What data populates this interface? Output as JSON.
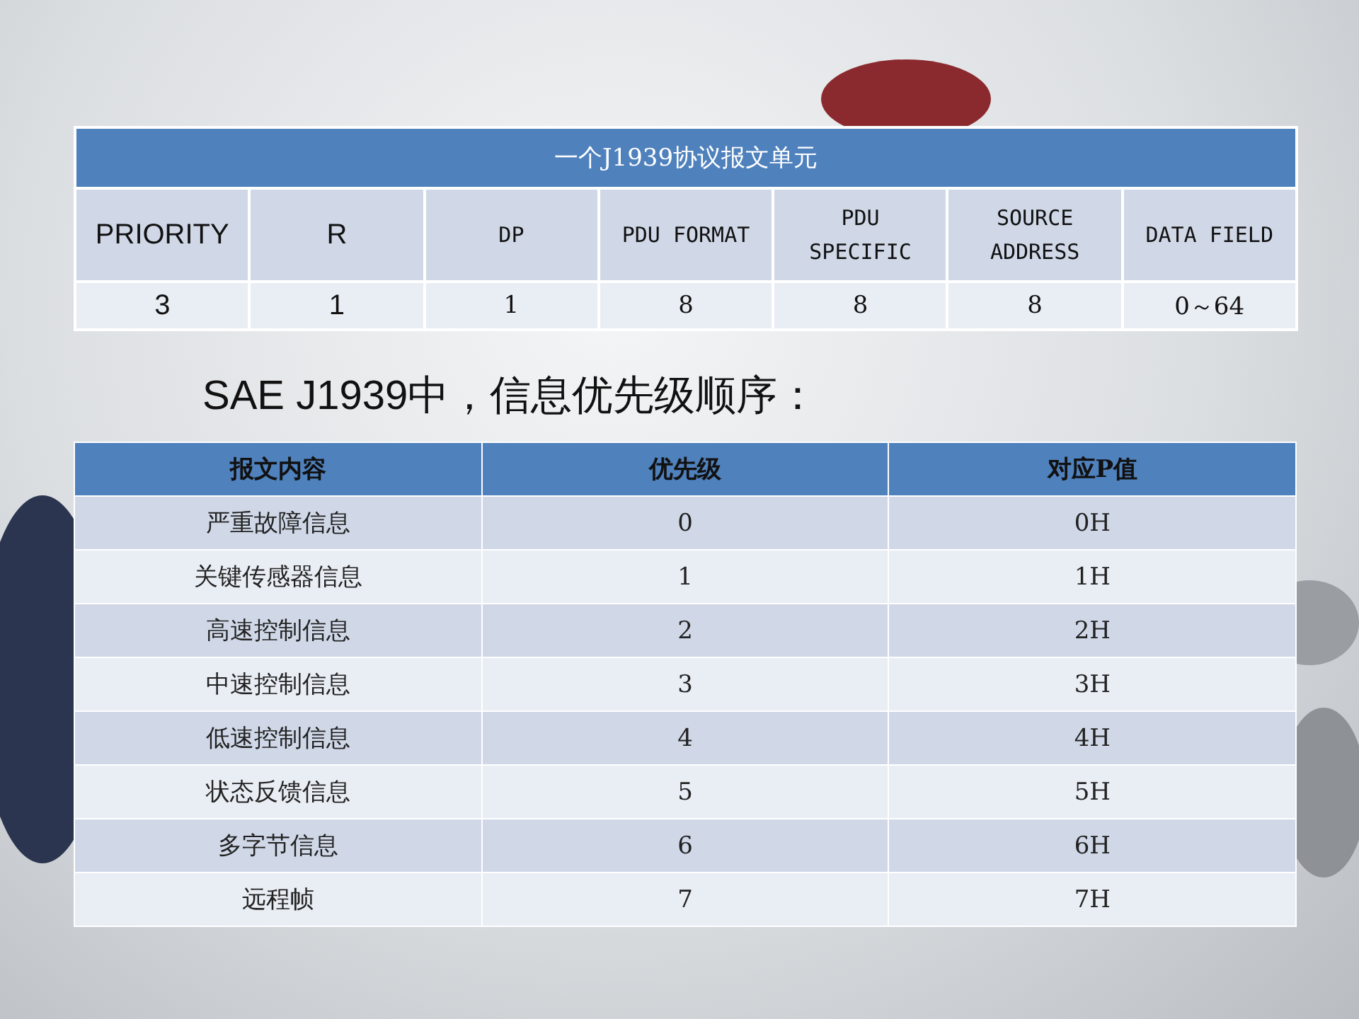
{
  "frame_table": {
    "title": "一个J1939协议报文单元",
    "columns": [
      "PRIORITY",
      "R",
      "DP",
      "PDU FORMAT",
      "PDU\nSPECIFIC",
      "SOURCE\nADDRESS",
      "DATA FIELD"
    ],
    "values": [
      "3",
      "1",
      "1",
      "8",
      "8",
      "8",
      "0～64"
    ]
  },
  "heading": "SAE J1939中，信息优先级顺序：",
  "priority_table": {
    "columns": [
      "报文内容",
      "优先级",
      "对应P值"
    ],
    "rows": [
      [
        "严重故障信息",
        "0",
        "0H"
      ],
      [
        "关键传感器信息",
        "1",
        "1H"
      ],
      [
        "高速控制信息",
        "2",
        "2H"
      ],
      [
        "中速控制信息",
        "3",
        "3H"
      ],
      [
        "低速控制信息",
        "4",
        "4H"
      ],
      [
        "状态反馈信息",
        "5",
        "5H"
      ],
      [
        "多字节信息",
        "6",
        "6H"
      ],
      [
        "远程帧",
        "7",
        "7H"
      ]
    ]
  }
}
